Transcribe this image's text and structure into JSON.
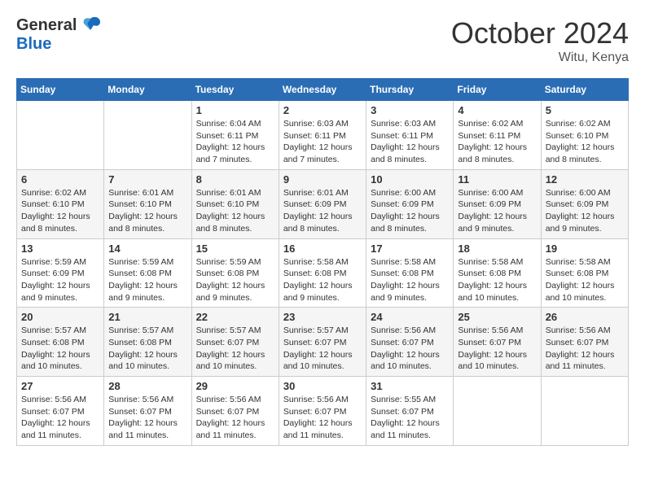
{
  "header": {
    "logo_general": "General",
    "logo_blue": "Blue",
    "month": "October 2024",
    "location": "Witu, Kenya"
  },
  "weekdays": [
    "Sunday",
    "Monday",
    "Tuesday",
    "Wednesday",
    "Thursday",
    "Friday",
    "Saturday"
  ],
  "weeks": [
    [
      {
        "day": "",
        "info": ""
      },
      {
        "day": "",
        "info": ""
      },
      {
        "day": "1",
        "info": "Sunrise: 6:04 AM\nSunset: 6:11 PM\nDaylight: 12 hours and 7 minutes."
      },
      {
        "day": "2",
        "info": "Sunrise: 6:03 AM\nSunset: 6:11 PM\nDaylight: 12 hours and 7 minutes."
      },
      {
        "day": "3",
        "info": "Sunrise: 6:03 AM\nSunset: 6:11 PM\nDaylight: 12 hours and 8 minutes."
      },
      {
        "day": "4",
        "info": "Sunrise: 6:02 AM\nSunset: 6:11 PM\nDaylight: 12 hours and 8 minutes."
      },
      {
        "day": "5",
        "info": "Sunrise: 6:02 AM\nSunset: 6:10 PM\nDaylight: 12 hours and 8 minutes."
      }
    ],
    [
      {
        "day": "6",
        "info": "Sunrise: 6:02 AM\nSunset: 6:10 PM\nDaylight: 12 hours and 8 minutes."
      },
      {
        "day": "7",
        "info": "Sunrise: 6:01 AM\nSunset: 6:10 PM\nDaylight: 12 hours and 8 minutes."
      },
      {
        "day": "8",
        "info": "Sunrise: 6:01 AM\nSunset: 6:10 PM\nDaylight: 12 hours and 8 minutes."
      },
      {
        "day": "9",
        "info": "Sunrise: 6:01 AM\nSunset: 6:09 PM\nDaylight: 12 hours and 8 minutes."
      },
      {
        "day": "10",
        "info": "Sunrise: 6:00 AM\nSunset: 6:09 PM\nDaylight: 12 hours and 8 minutes."
      },
      {
        "day": "11",
        "info": "Sunrise: 6:00 AM\nSunset: 6:09 PM\nDaylight: 12 hours and 9 minutes."
      },
      {
        "day": "12",
        "info": "Sunrise: 6:00 AM\nSunset: 6:09 PM\nDaylight: 12 hours and 9 minutes."
      }
    ],
    [
      {
        "day": "13",
        "info": "Sunrise: 5:59 AM\nSunset: 6:09 PM\nDaylight: 12 hours and 9 minutes."
      },
      {
        "day": "14",
        "info": "Sunrise: 5:59 AM\nSunset: 6:08 PM\nDaylight: 12 hours and 9 minutes."
      },
      {
        "day": "15",
        "info": "Sunrise: 5:59 AM\nSunset: 6:08 PM\nDaylight: 12 hours and 9 minutes."
      },
      {
        "day": "16",
        "info": "Sunrise: 5:58 AM\nSunset: 6:08 PM\nDaylight: 12 hours and 9 minutes."
      },
      {
        "day": "17",
        "info": "Sunrise: 5:58 AM\nSunset: 6:08 PM\nDaylight: 12 hours and 9 minutes."
      },
      {
        "day": "18",
        "info": "Sunrise: 5:58 AM\nSunset: 6:08 PM\nDaylight: 12 hours and 10 minutes."
      },
      {
        "day": "19",
        "info": "Sunrise: 5:58 AM\nSunset: 6:08 PM\nDaylight: 12 hours and 10 minutes."
      }
    ],
    [
      {
        "day": "20",
        "info": "Sunrise: 5:57 AM\nSunset: 6:08 PM\nDaylight: 12 hours and 10 minutes."
      },
      {
        "day": "21",
        "info": "Sunrise: 5:57 AM\nSunset: 6:08 PM\nDaylight: 12 hours and 10 minutes."
      },
      {
        "day": "22",
        "info": "Sunrise: 5:57 AM\nSunset: 6:07 PM\nDaylight: 12 hours and 10 minutes."
      },
      {
        "day": "23",
        "info": "Sunrise: 5:57 AM\nSunset: 6:07 PM\nDaylight: 12 hours and 10 minutes."
      },
      {
        "day": "24",
        "info": "Sunrise: 5:56 AM\nSunset: 6:07 PM\nDaylight: 12 hours and 10 minutes."
      },
      {
        "day": "25",
        "info": "Sunrise: 5:56 AM\nSunset: 6:07 PM\nDaylight: 12 hours and 10 minutes."
      },
      {
        "day": "26",
        "info": "Sunrise: 5:56 AM\nSunset: 6:07 PM\nDaylight: 12 hours and 11 minutes."
      }
    ],
    [
      {
        "day": "27",
        "info": "Sunrise: 5:56 AM\nSunset: 6:07 PM\nDaylight: 12 hours and 11 minutes."
      },
      {
        "day": "28",
        "info": "Sunrise: 5:56 AM\nSunset: 6:07 PM\nDaylight: 12 hours and 11 minutes."
      },
      {
        "day": "29",
        "info": "Sunrise: 5:56 AM\nSunset: 6:07 PM\nDaylight: 12 hours and 11 minutes."
      },
      {
        "day": "30",
        "info": "Sunrise: 5:56 AM\nSunset: 6:07 PM\nDaylight: 12 hours and 11 minutes."
      },
      {
        "day": "31",
        "info": "Sunrise: 5:55 AM\nSunset: 6:07 PM\nDaylight: 12 hours and 11 minutes."
      },
      {
        "day": "",
        "info": ""
      },
      {
        "day": "",
        "info": ""
      }
    ]
  ]
}
